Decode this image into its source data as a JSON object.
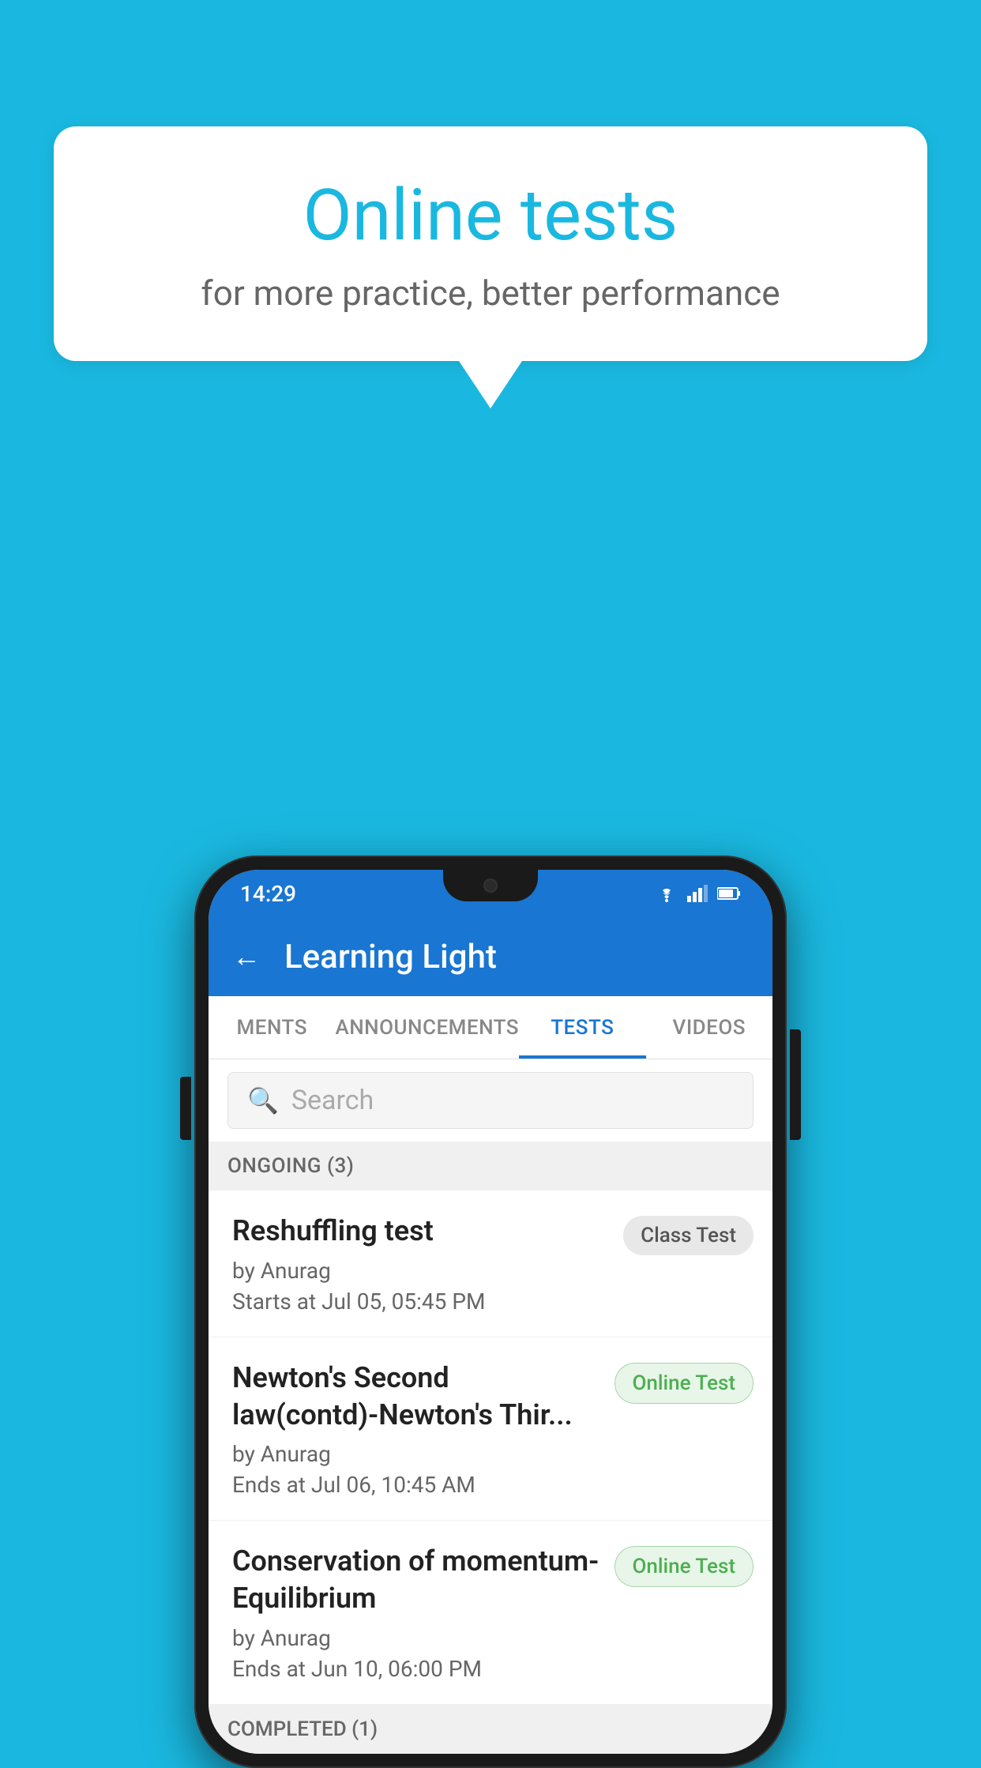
{
  "background_color": "#1ab8e0",
  "bubble": {
    "title": "Online tests",
    "subtitle": "for more practice, better performance"
  },
  "phone": {
    "status_bar": {
      "time": "14:29"
    },
    "app_bar": {
      "title": "Learning Light",
      "back_icon": "←"
    },
    "tabs": [
      {
        "label": "MENTS",
        "active": false
      },
      {
        "label": "ANNOUNCEMENTS",
        "active": false
      },
      {
        "label": "TESTS",
        "active": true
      },
      {
        "label": "VIDEOS",
        "active": false
      }
    ],
    "search": {
      "placeholder": "Search"
    },
    "ongoing_section": {
      "label": "ONGOING (3)"
    },
    "tests": [
      {
        "name": "Reshuffling test",
        "by": "by Anurag",
        "time_label": "Starts at",
        "time": "Jul 05, 05:45 PM",
        "badge": "Class Test",
        "badge_type": "class"
      },
      {
        "name": "Newton's Second law(contd)-Newton's Thir...",
        "by": "by Anurag",
        "time_label": "Ends at",
        "time": "Jul 06, 10:45 AM",
        "badge": "Online Test",
        "badge_type": "online"
      },
      {
        "name": "Conservation of momentum-Equilibrium",
        "by": "by Anurag",
        "time_label": "Ends at",
        "time": "Jun 10, 06:00 PM",
        "badge": "Online Test",
        "badge_type": "online"
      }
    ],
    "completed_section": {
      "label": "COMPLETED (1)"
    }
  }
}
